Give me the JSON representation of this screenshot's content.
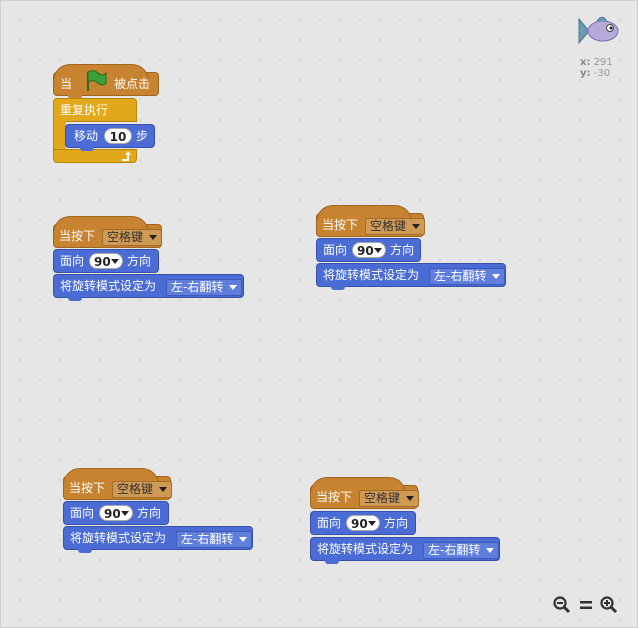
{
  "sprite": {
    "icon": "fish-sprite-icon",
    "x_label": "x:",
    "x_value": "291",
    "y_label": "y:",
    "y_value": "-30"
  },
  "script1": {
    "hat_prefix": "当",
    "hat_suffix": "被点击",
    "forever": "重复执行",
    "move_prefix": "移动",
    "move_steps": "10",
    "move_suffix": "步"
  },
  "keypress": {
    "prefix": "当按下",
    "key": "空格键"
  },
  "point": {
    "prefix": "面向",
    "value": "90",
    "suffix": "方向"
  },
  "rotation": {
    "prefix": "将旋转模式设定为",
    "mode": "左-右翻转"
  },
  "zoom": {
    "out": "zoom-out-icon",
    "reset": "zoom-reset-icon",
    "in": "zoom-in-icon"
  },
  "colors": {
    "events": "#c88330",
    "motion": "#4a6cd4",
    "control": "#e1a91a",
    "flag": "#3aa03a"
  }
}
